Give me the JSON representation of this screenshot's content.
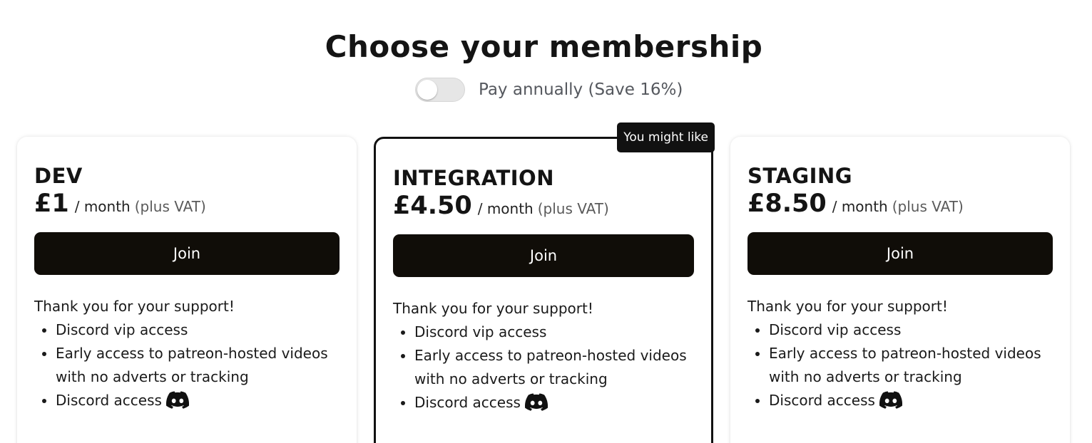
{
  "header": {
    "title": "Choose your membership",
    "billing_toggle_label": "Pay annually (Save 16%)",
    "billing_toggle_on": false
  },
  "tiers": [
    {
      "name": "DEV",
      "price": "£1",
      "period": "/ month",
      "vat_note": "(plus VAT)",
      "button_label": "Join",
      "featured": false,
      "badge": "",
      "intro": "Thank you for your support!",
      "perks": [
        "Discord vip access",
        "Early access to patreon-hosted videos with no adverts or tracking",
        "Discord access"
      ]
    },
    {
      "name": "INTEGRATION",
      "price": "£4.50",
      "period": "/ month",
      "vat_note": "(plus VAT)",
      "button_label": "Join",
      "featured": true,
      "badge": "You might like",
      "intro": "Thank you for your support!",
      "perks": [
        "Discord vip access",
        "Early access to patreon-hosted videos with no adverts or tracking",
        "Discord access"
      ]
    },
    {
      "name": "STAGING",
      "price": "£8.50",
      "period": "/ month",
      "vat_note": "(plus VAT)",
      "button_label": "Join",
      "featured": false,
      "badge": "",
      "intro": "Thank you for your support!",
      "perks": [
        "Discord vip access",
        "Early access to patreon-hosted videos with no adverts or tracking",
        "Discord access"
      ]
    }
  ],
  "icons": {
    "discord": "discord-icon"
  },
  "colors": {
    "button_bg": "#100d08",
    "badge_bg": "#111111",
    "toggle_off_bg": "#e6e6e6",
    "muted_text": "#55585e"
  }
}
